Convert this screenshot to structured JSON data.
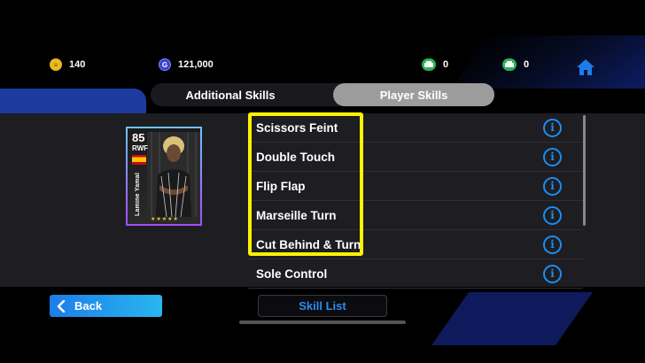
{
  "currency": {
    "ecoins": "140",
    "gp": "121,000",
    "ticket_a": "0",
    "ticket_b": "0"
  },
  "tabs": [
    {
      "label": "Additional Skills",
      "active": false
    },
    {
      "label": "Player Skills",
      "active": true
    }
  ],
  "player_card": {
    "rating": "85",
    "position": "RWF",
    "name": "Lamine Yamal",
    "stars": "★★★★★"
  },
  "skills": [
    {
      "label": "Scissors Feint"
    },
    {
      "label": "Double Touch"
    },
    {
      "label": "Flip Flap"
    },
    {
      "label": "Marseille Turn"
    },
    {
      "label": "Cut Behind & Turn"
    },
    {
      "label": "Sole Control"
    }
  ],
  "buttons": {
    "back": "Back",
    "skill_list": "Skill List"
  },
  "colors": {
    "accent_blue": "#1d8df0",
    "highlight_yellow": "#fff200",
    "tab_active": "#9c9c9c"
  }
}
